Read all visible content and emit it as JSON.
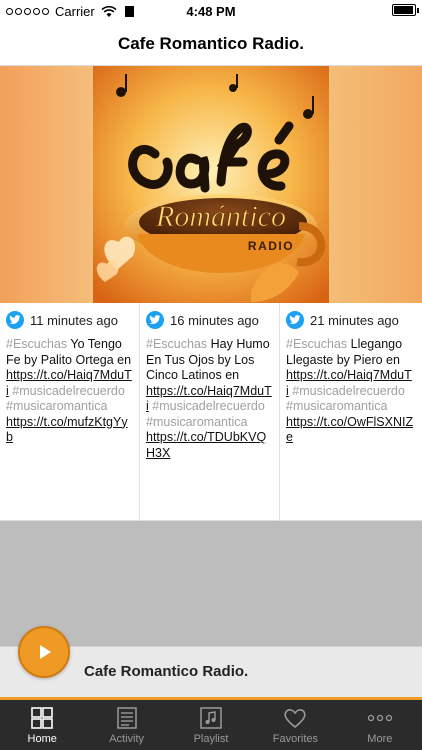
{
  "status_bar": {
    "carrier": "Carrier",
    "time": "4:48 PM",
    "battery_level": 0.95
  },
  "nav": {
    "title": "Cafe Romantico Radio."
  },
  "hero": {
    "logo_script": "café",
    "logo_subtitle": "Romántico",
    "logo_tag": "RADIO"
  },
  "tweets": [
    {
      "time": "11 minutes ago",
      "parts": [
        {
          "text": "#Escuchas",
          "kind": "hashtag"
        },
        {
          "text": " Yo Tengo Fe by Palito Ortega en ",
          "kind": "text"
        },
        {
          "text": "https://t.co/Haiq7MduTi",
          "kind": "link"
        },
        {
          "text": " #musicadelrecuerdo #musicaromantica ",
          "kind": "hashtag"
        },
        {
          "text": "https://t.co/mufzKtgYyb",
          "kind": "link"
        }
      ]
    },
    {
      "time": "16 minutes ago",
      "parts": [
        {
          "text": "#Escuchas",
          "kind": "hashtag"
        },
        {
          "text": " Hay Humo En Tus Ojos by Los Cinco Latinos en ",
          "kind": "text"
        },
        {
          "text": "https://t.co/Haiq7MduTi",
          "kind": "link"
        },
        {
          "text": " #musicadelrecuerdo #musicaromantica ",
          "kind": "hashtag"
        },
        {
          "text": "https://t.co/TDUbKVQH3X",
          "kind": "link"
        }
      ]
    },
    {
      "time": "21 minutes ago",
      "parts": [
        {
          "text": "#Escuchas",
          "kind": "hashtag"
        },
        {
          "text": " Llegango Llegaste by Piero en ",
          "kind": "text"
        },
        {
          "text": "https://t.co/Haiq7MduTi",
          "kind": "link"
        },
        {
          "text": " #musicadelrecuerdo #musicaromantica ",
          "kind": "hashtag"
        },
        {
          "text": "https://t.co/OwFlSXNIZe",
          "kind": "link"
        }
      ]
    }
  ],
  "player": {
    "title": "Cafe Romantico Radio.",
    "play_icon": "play-icon"
  },
  "tabs": [
    {
      "label": "Home",
      "icon": "home-grid-icon",
      "active": true
    },
    {
      "label": "Activity",
      "icon": "activity-list-icon",
      "active": false
    },
    {
      "label": "Playlist",
      "icon": "playlist-music-icon",
      "active": false
    },
    {
      "label": "Favorites",
      "icon": "heart-icon",
      "active": false
    },
    {
      "label": "More",
      "icon": "more-dots-icon",
      "active": false
    }
  ],
  "colors": {
    "accent": "#f09a26",
    "twitter": "#1da1f2",
    "tab_bar": "#2b2b2b",
    "hashtag": "#a0a0a0"
  }
}
